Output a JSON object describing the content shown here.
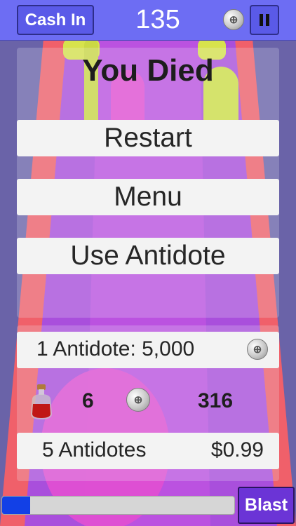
{
  "hud": {
    "cash_in_label": "Cash In",
    "score": "135",
    "coin_icon": "coin-icon",
    "pause_icon": "pause-icon"
  },
  "death_menu": {
    "title": "You Died",
    "restart_label": "Restart",
    "menu_label": "Menu",
    "use_antidote_label": "Use Antidote"
  },
  "shop": {
    "single_offer_label": "1 Antidote: 5,000",
    "antidote_count": "6",
    "coin_total": "316",
    "bundle_label": "5 Antidotes",
    "bundle_price": "$0.99"
  },
  "bottom": {
    "blast_label": "Blast",
    "blast_progress": 0.12
  },
  "colors": {
    "hud_bar": "#6d6df3",
    "blast_button": "#6b34d6",
    "progress_fill": "#1240e6",
    "track_red": "#f0606a",
    "track_purple": "#b54bd7"
  }
}
